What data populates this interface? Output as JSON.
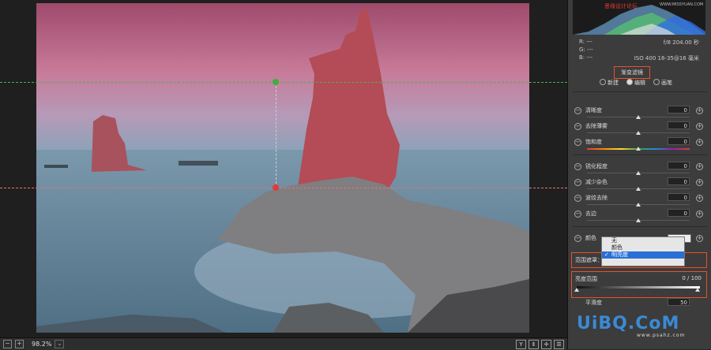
{
  "canvas": {
    "zoom": "98.2%"
  },
  "statusbar": {
    "right_buttons": [
      "Y",
      "⇕",
      "✢",
      "☰"
    ]
  },
  "histogram": {
    "watermark_text": "思缘设计论坛",
    "watermark_url": "WWW.MISSYUAN.COM"
  },
  "info": {
    "r_label": "R:",
    "r_val": "---",
    "g_label": "G:",
    "g_val": "---",
    "b_label": "B:",
    "b_val": "---",
    "aperture_shutter": "f/8   204.00 秒",
    "iso_lens": "ISO 400   16-35@16 毫米"
  },
  "tool": {
    "title": "渐变滤镜",
    "modes": [
      "新建",
      "编辑",
      "画笔"
    ],
    "active_mode": 1
  },
  "sliders": [
    {
      "label": "清晰度",
      "value": "0"
    },
    {
      "label": "去除薄雾",
      "value": "0"
    },
    {
      "label": "饱和度",
      "value": "0"
    },
    {
      "label": "锐化程度",
      "value": "0"
    },
    {
      "label": "减少杂色",
      "value": "0"
    },
    {
      "label": "波纹去除",
      "value": "0"
    },
    {
      "label": "去边",
      "value": "0"
    }
  ],
  "color_row": {
    "label": "颜色"
  },
  "mask": {
    "label": "范围遮罩：",
    "options": [
      "无",
      "颜色",
      "明亮度"
    ],
    "selected": "明亮度"
  },
  "luminance_range": {
    "label": "亮度范围",
    "value": "0 / 100"
  },
  "smoothness": {
    "label": "平滑度",
    "value": "50"
  },
  "watermark": {
    "logo": "UiBQ.CoM",
    "sub": "www.psahz.com"
  },
  "colors": {
    "accent_orange": "#e8512b",
    "select_blue": "#2a6fd6",
    "guide_green": "#4caf50",
    "guide_red": "#e57373"
  }
}
